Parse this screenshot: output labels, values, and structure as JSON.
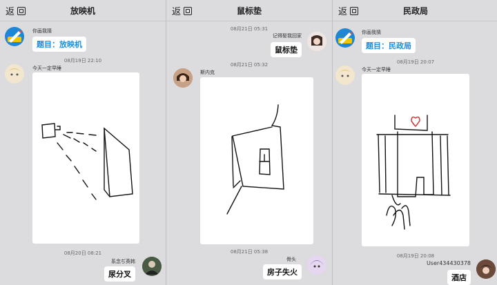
{
  "panels": [
    {
      "back_label": "返",
      "title": "放映机",
      "sys_nick": "你画我猜",
      "prompt": "题目：放映机",
      "ts1": "08月19日 22:10",
      "drawer_nick": "今天一定早睡",
      "ts2": "08月20日 08:21",
      "guess_nick": "系念ぢ英韩",
      "guess": "尿分叉"
    },
    {
      "back_label": "返",
      "title": "鼠标垫",
      "ts0": "08月21日 05:31",
      "self_nick": "记得娶我回家",
      "self_msg": "鼠标垫",
      "ts1": "08月21日 05:32",
      "drawer_nick": "斯内克",
      "ts2": "08月21日 05:38",
      "guess_nick": "骨头",
      "guess": "房子失火"
    },
    {
      "back_label": "返",
      "title": "民政局",
      "sys_nick": "你画我猜",
      "prompt": "题目：民政局",
      "ts1": "08月19日 20:07",
      "drawer_nick": "今天一定早睡",
      "ts2": "08月19日 20:08",
      "guess_nick": "User434430378",
      "guess": "酒店"
    }
  ],
  "colors": {
    "prompt_blue": "#1a8fe0",
    "heart_red": "#d33333"
  }
}
